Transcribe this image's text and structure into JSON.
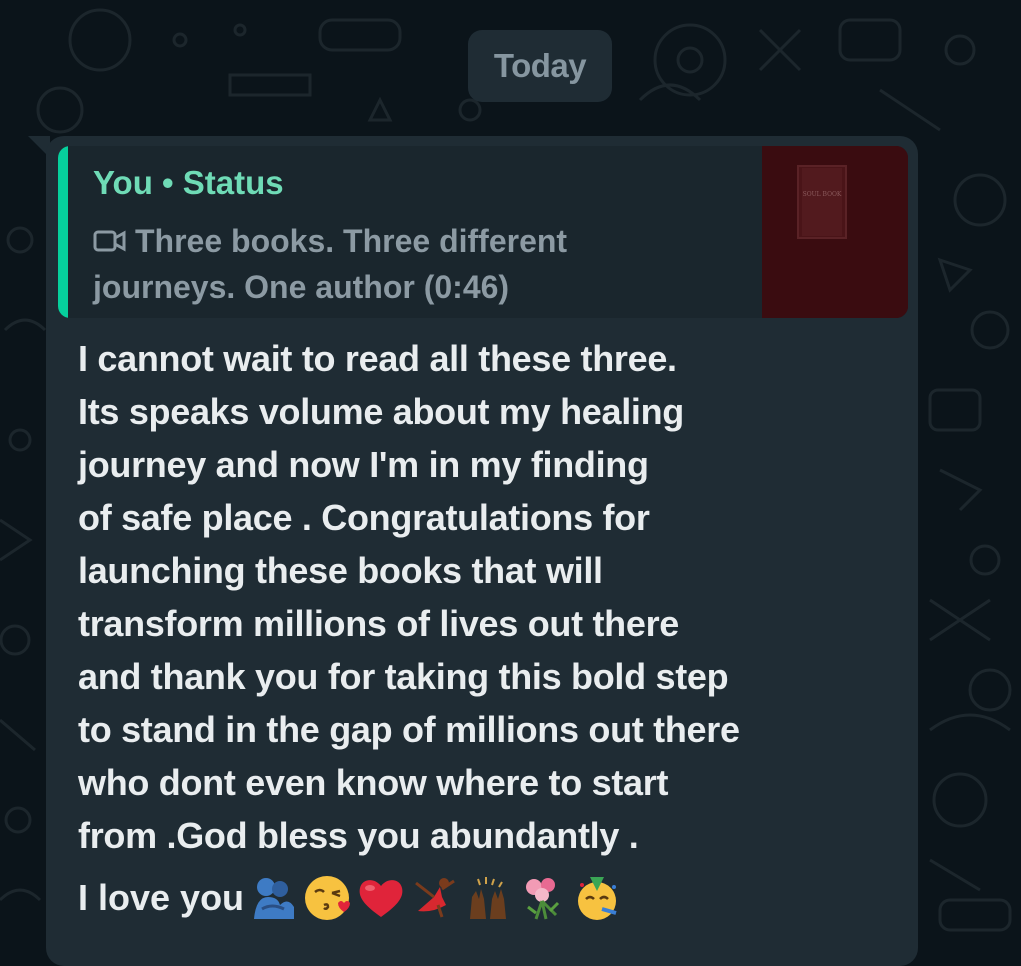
{
  "chat": {
    "date_separator": "Today"
  },
  "message": {
    "reply_quote": {
      "title": "You • Status",
      "description": "Three books. Three different journeys. One author (0:46)",
      "icon": "video-camera-icon",
      "accent_color": "#06cf9c",
      "thumbnail_text": "SOUL BOOK"
    },
    "body": "I cannot wait to read all these three.\nIts speaks volume about my healing\njourney and now I'm in my finding\nof safe place . Congratulations for\nlaunching these books that will\ntransform millions of lives out there\nand thank you for taking this bold step\nto stand in the gap of millions out there\nwho dont even know where to start\nfrom .God bless you abundantly .",
    "closing": "I love you",
    "emojis": [
      "people-hugging-emoji",
      "face-blowing-kiss-emoji",
      "red-heart-emoji",
      "woman-dancing-emoji",
      "raising-hands-emoji",
      "bouquet-emoji",
      "partying-face-emoji"
    ]
  },
  "colors": {
    "background": "#0b141a",
    "bubble": "#1f2c34",
    "text": "#e9edef",
    "muted": "#8696a0"
  }
}
